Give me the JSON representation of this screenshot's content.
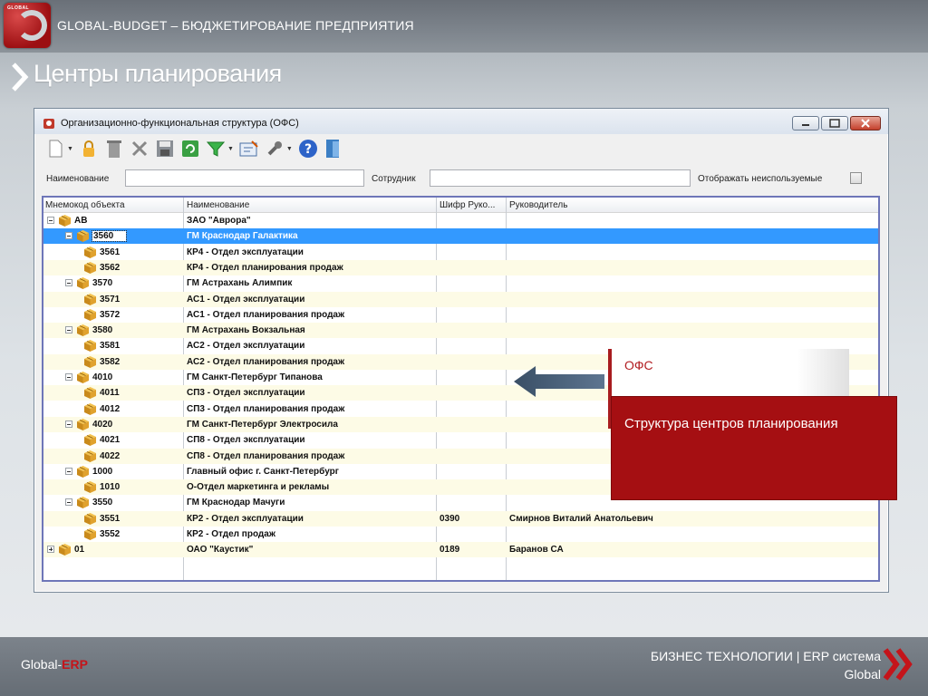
{
  "header": {
    "title": "GLOBAL-BUDGET – БЮДЖЕТИРОВАНИЕ ПРЕДПРИЯТИЯ",
    "logo_text": "GLOBAL"
  },
  "page": {
    "title": "Центры планирования"
  },
  "window": {
    "title": "Организационно-функциональная структура (ОФС)",
    "filters": {
      "name_label": "Наименование",
      "employee_label": "Сотрудник",
      "show_unused_label": "Отображать неиспользуемые"
    },
    "columns": [
      "Мнемокод объекта",
      "Наименование",
      "Шифр Руко...",
      "Руководитель"
    ],
    "rows": [
      {
        "code": "АВ",
        "name": "ЗАО \"Аврора\"",
        "cipher": "",
        "manager": "",
        "level": 0,
        "toggle": "minus"
      },
      {
        "code": "3560",
        "name": "ГМ Краснодар Галактика",
        "cipher": "",
        "manager": "",
        "level": 1,
        "toggle": "minus",
        "selected": true
      },
      {
        "code": "3561",
        "name": "КР4 - Отдел эксплуатации",
        "cipher": "",
        "manager": "",
        "level": 2
      },
      {
        "code": "3562",
        "name": "КР4 - Отдел планирования продаж",
        "cipher": "",
        "manager": "",
        "level": 2
      },
      {
        "code": "3570",
        "name": "ГМ Астрахань Алимпик",
        "cipher": "",
        "manager": "",
        "level": 1,
        "toggle": "minus"
      },
      {
        "code": "3571",
        "name": "АС1 - Отдел эксплуатации",
        "cipher": "",
        "manager": "",
        "level": 2
      },
      {
        "code": "3572",
        "name": "АС1 - Отдел планирования продаж",
        "cipher": "",
        "manager": "",
        "level": 2
      },
      {
        "code": "3580",
        "name": "ГМ Астрахань Вокзальная",
        "cipher": "",
        "manager": "",
        "level": 1,
        "toggle": "minus"
      },
      {
        "code": "3581",
        "name": "АС2 - Отдел эксплуатации",
        "cipher": "",
        "manager": "",
        "level": 2
      },
      {
        "code": "3582",
        "name": "АС2 - Отдел планирования продаж",
        "cipher": "",
        "manager": "",
        "level": 2
      },
      {
        "code": "4010",
        "name": "ГМ Санкт-Петербург Типанова",
        "cipher": "",
        "manager": "",
        "level": 1,
        "toggle": "minus"
      },
      {
        "code": "4011",
        "name": "СП3 - Отдел эксплуатации",
        "cipher": "",
        "manager": "",
        "level": 2
      },
      {
        "code": "4012",
        "name": "СП3 - Отдел планирования продаж",
        "cipher": "",
        "manager": "",
        "level": 2
      },
      {
        "code": "4020",
        "name": "ГМ Санкт-Петербург Электросила",
        "cipher": "",
        "manager": "",
        "level": 1,
        "toggle": "minus"
      },
      {
        "code": "4021",
        "name": "СП8 - Отдел эксплуатации",
        "cipher": "",
        "manager": "",
        "level": 2
      },
      {
        "code": "4022",
        "name": "СП8 - Отдел планирования продаж",
        "cipher": "",
        "manager": "",
        "level": 2
      },
      {
        "code": "1000",
        "name": "Главный офис г. Санкт-Петербург",
        "cipher": "",
        "manager": "",
        "level": 1,
        "toggle": "minus"
      },
      {
        "code": "1010",
        "name": "О-Отдел маркетинга и рекламы",
        "cipher": "",
        "manager": "",
        "level": 2
      },
      {
        "code": "3550",
        "name": "ГМ Краснодар Мачуги",
        "cipher": "",
        "manager": "",
        "level": 1,
        "toggle": "minus"
      },
      {
        "code": "3551",
        "name": "КР2 - Отдел эксплуатации",
        "cipher": "0390",
        "manager": "Смирнов Виталий Анатольевич",
        "level": 2
      },
      {
        "code": "3552",
        "name": "КР2 - Отдел продаж",
        "cipher": "",
        "manager": "",
        "level": 2
      },
      {
        "code": "01",
        "name": "ОАО \"Каустик\"",
        "cipher": "0189",
        "manager": "Баранов СА",
        "level": 0,
        "toggle": "plus"
      }
    ]
  },
  "callout": {
    "label": "ОФС",
    "description": "Структура центров планирования"
  },
  "footer": {
    "brand_prefix": "Global-",
    "brand_accent": "ERP",
    "tagline_line1": "БИЗНЕС ТЕХНОЛОГИИ | ERP система",
    "tagline_line2": "Global"
  },
  "colors": {
    "accent_red": "#a50f12",
    "selection": "#3399ff",
    "alt_row": "#fdfbe6"
  }
}
